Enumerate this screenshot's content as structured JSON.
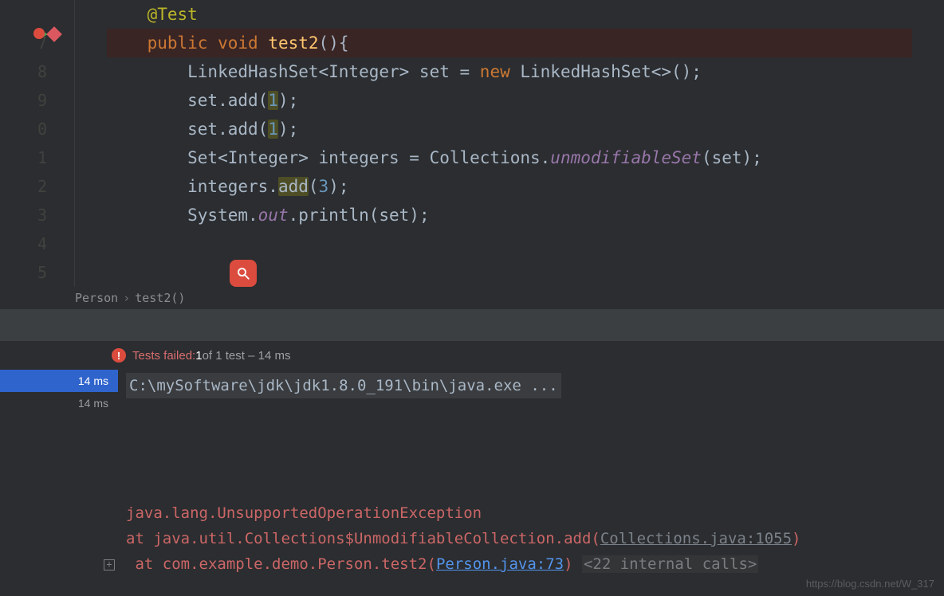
{
  "gutter": {
    "lines": [
      "",
      "7",
      "8",
      "9",
      "0",
      "1",
      "2",
      "3",
      "4",
      "5"
    ]
  },
  "code": {
    "l0": {
      "ann": "@Test"
    },
    "l1": {
      "kw1": "public",
      "kw2": "void",
      "fn": "test2",
      "tail": "(){"
    },
    "l2": {
      "pre": "        LinkedHashSet<Integer> set = ",
      "kw": "new",
      "post": " LinkedHashSet<>();"
    },
    "l3": {
      "pre": "        set.add(",
      "n": "1",
      "post": ");"
    },
    "l4": {
      "pre": "        set.add(",
      "n": "1",
      "post": ");"
    },
    "l5": {
      "pre": "        Set<Integer> integers = Collections.",
      "it": "unmodifiableSet",
      "post": "(set);"
    },
    "l6": {
      "pre": "        integers.",
      "hl": "add",
      "post": "(",
      "n": "3",
      "post2": ");"
    },
    "l7": {
      "pre": "        System.",
      "it": "out",
      "mid": ".println(set);"
    }
  },
  "breadcrumb": {
    "a": "Person",
    "b": "test2()"
  },
  "results": {
    "fail_label": "Tests failed: ",
    "fail_count": "1",
    "rest": " of 1 test – 14 ms"
  },
  "tests": {
    "rows": [
      "14 ms",
      "14 ms"
    ]
  },
  "console": {
    "cmd": "C:\\mySoftware\\jdk\\jdk1.8.0_191\\bin\\java.exe ...",
    "exc": "java.lang.UnsupportedOperationException",
    "at1_pre": "    at java.util.Collections$UnmodifiableCollection.add(",
    "at1_link": "Collections.java:1055",
    "at1_post": ")",
    "at2_pre": "    at com.example.demo.Person.test2(",
    "at2_link": "Person.java:73",
    "at2_post": ") ",
    "at2_grey": "<22 internal calls>"
  },
  "watermark": "https://blog.csdn.net/W_317"
}
